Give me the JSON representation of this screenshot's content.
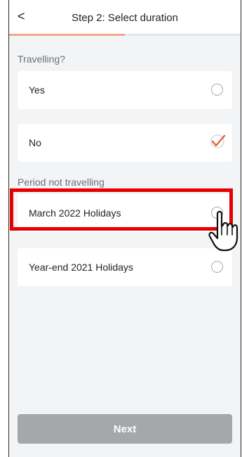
{
  "header": {
    "back_icon": "chevron-left-icon",
    "back_glyph": "<",
    "title": "Step 2: Select duration",
    "progress_fraction": 0.5,
    "progress_color": "#f4a58a"
  },
  "travelling": {
    "label": "Travelling?",
    "options": [
      {
        "label": "Yes",
        "selected": false
      },
      {
        "label": "No",
        "selected": true
      }
    ]
  },
  "period": {
    "label": "Period not travelling",
    "options": [
      {
        "label": "March 2022 Holidays",
        "selected": false,
        "highlighted": true
      },
      {
        "label": "Year-end 2021 Holidays",
        "selected": false
      }
    ]
  },
  "footer": {
    "next_label": "Next",
    "next_enabled": false
  },
  "colors": {
    "accent": "#e8553a",
    "highlight": "#e60000",
    "disabled_button": "#a5a7ab"
  },
  "icons": {
    "selected": "checkmark-icon",
    "unselected": "radio-empty-icon",
    "pointer": "hand-pointer-icon"
  }
}
